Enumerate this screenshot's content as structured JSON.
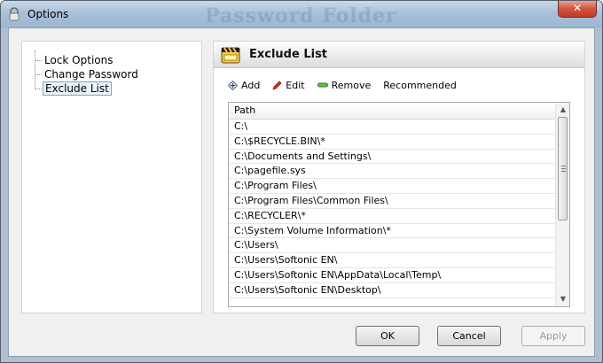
{
  "window": {
    "title": "Options",
    "background_text": "Password Folder"
  },
  "tree": {
    "items": [
      {
        "label": "Lock Options",
        "selected": false
      },
      {
        "label": "Change Password",
        "selected": false
      },
      {
        "label": "Exclude List",
        "selected": true
      }
    ]
  },
  "panel": {
    "title": "Exclude List",
    "toolbar": {
      "add": "Add",
      "edit": "Edit",
      "remove": "Remove",
      "recommended": "Recommended"
    },
    "list": {
      "column_header": "Path",
      "rows": [
        "C:\\",
        "C:\\$RECYCLE.BIN\\*",
        "C:\\Documents and Settings\\",
        "C:\\pagefile.sys",
        "C:\\Program Files\\",
        "C:\\Program Files\\Common Files\\",
        "C:\\RECYCLER\\*",
        "C:\\System Volume Information\\*",
        "C:\\Users\\",
        "C:\\Users\\Softonic EN\\",
        "C:\\Users\\Softonic EN\\AppData\\Local\\Temp\\",
        "C:\\Users\\Softonic EN\\Desktop\\"
      ]
    }
  },
  "buttons": {
    "ok": "OK",
    "cancel": "Cancel",
    "apply": "Apply"
  },
  "colors": {
    "title_bar": "#a9c0d8",
    "close_button": "#d2553f",
    "selection_border": "#7da2ce"
  }
}
